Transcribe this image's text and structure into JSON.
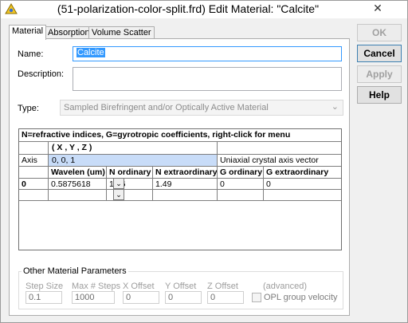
{
  "window": {
    "title": "(51-polarization-color-split.frd) Edit Material: \"Calcite\"",
    "close_glyph": "✕"
  },
  "tabs": [
    {
      "label": "Material",
      "active": true
    },
    {
      "label": "Absorption",
      "active": false
    },
    {
      "label": "Volume Scatter",
      "active": false
    }
  ],
  "form": {
    "name_label": "Name:",
    "name_value": "Calcite",
    "description_label": "Description:",
    "description_value": "",
    "type_label": "Type:",
    "type_value": "Sampled Birefringent and/or Optically Active Material",
    "dropdown_arrow": "⌄"
  },
  "grid": {
    "header": "N=refractive indices,  G=gyrotropic coefficients,  right-click for menu",
    "axis_col_header": "( X , Y , Z )",
    "axis_label": "Axis",
    "axis_value": "0,  0,  1",
    "axis_desc": "Uniaxial crystal axis vector",
    "columns": [
      "Wavelen (um)",
      "N ordinary",
      "N extraordinary",
      "G ordinary",
      "G extraordinary"
    ],
    "rows": [
      {
        "index": "0",
        "wavelen": "0.5875618",
        "n_ord": "1.66",
        "n_ext": "1.49",
        "g_ord": "0",
        "g_ext": "0"
      },
      {
        "index": "",
        "wavelen": "",
        "n_ord": "",
        "n_ext": "",
        "g_ord": "",
        "g_ext": ""
      }
    ],
    "dropdown_glyph": "⌄"
  },
  "other_params": {
    "title": "Other Material Parameters",
    "step_size_label": "Step Size",
    "step_size_value": "0.1",
    "max_steps_label": "Max # Steps",
    "max_steps_value": "1000",
    "x_offset_label": "X Offset",
    "x_offset_value": "0",
    "y_offset_label": "Y Offset",
    "y_offset_value": "0",
    "z_offset_label": "Z Offset",
    "z_offset_value": "0",
    "advanced_label": "(advanced)",
    "opl_label": "OPL group velocity"
  },
  "buttons": {
    "ok": "OK",
    "cancel": "Cancel",
    "apply": "Apply",
    "help": "Help"
  },
  "colors": {
    "accent": "#3399ff",
    "axis_highlight": "#c8dcf8",
    "disabled": "#a0a0a0"
  }
}
